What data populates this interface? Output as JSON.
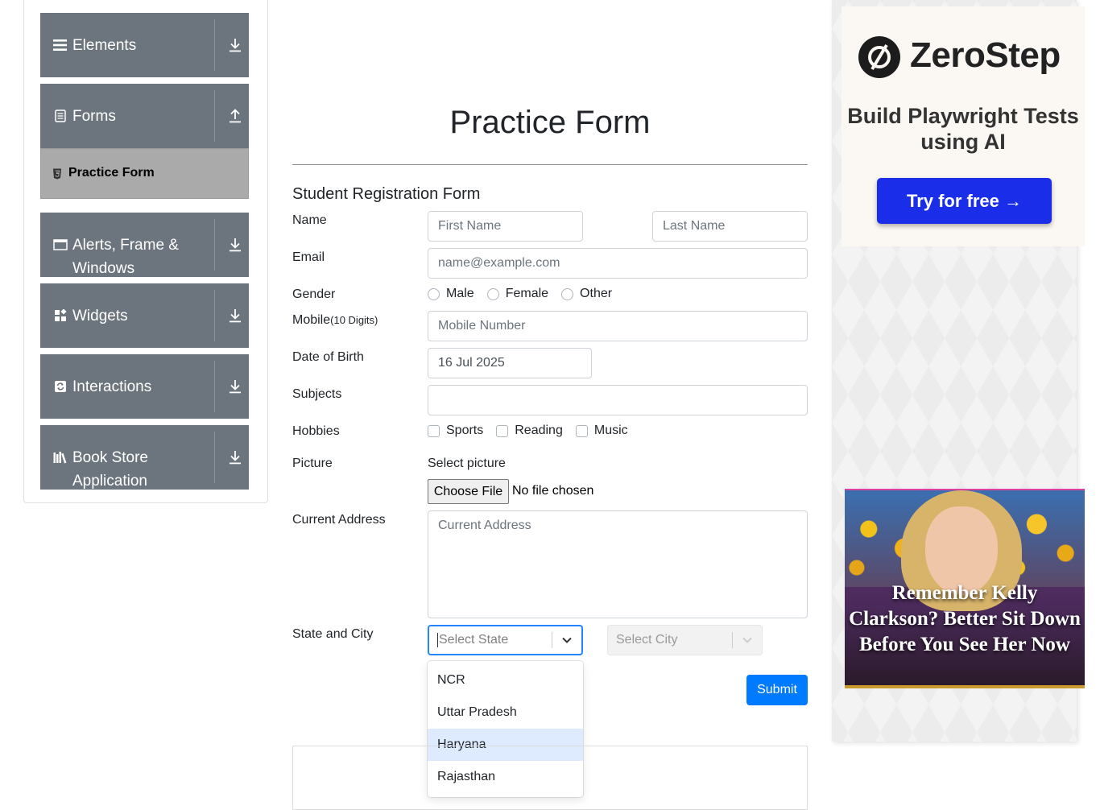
{
  "sidebar": {
    "groups": [
      {
        "label": "Elements",
        "icon": "list-icon",
        "arrow": "download-arrow-icon"
      },
      {
        "label": "Forms",
        "icon": "document-icon",
        "arrow": "upload-arrow-icon"
      },
      {
        "label": "Alerts, Frame & Windows",
        "icon": "window-icon",
        "arrow": "download-arrow-icon"
      },
      {
        "label": "Widgets",
        "icon": "widgets-icon",
        "arrow": "download-arrow-icon"
      },
      {
        "label": "Interactions",
        "icon": "interactions-icon",
        "arrow": "download-arrow-icon"
      },
      {
        "label": "Book Store Application",
        "icon": "books-icon",
        "arrow": "download-arrow-icon"
      }
    ],
    "active_item": "Practice Form"
  },
  "page": {
    "title": "Practice Form",
    "form_heading": "Student Registration Form"
  },
  "form": {
    "name_label": "Name",
    "first_name_placeholder": "First Name",
    "last_name_placeholder": "Last Name",
    "email_label": "Email",
    "email_placeholder": "name@example.com",
    "gender_label": "Gender",
    "gender_options": [
      "Male",
      "Female",
      "Other"
    ],
    "mobile_label": "Mobile",
    "mobile_hint": "(10 Digits)",
    "mobile_placeholder": "Mobile Number",
    "dob_label": "Date of Birth",
    "dob_value": "16 Jul 2025",
    "subjects_label": "Subjects",
    "subjects_value": "",
    "hobbies_label": "Hobbies",
    "hobbies_options": [
      "Sports",
      "Reading",
      "Music"
    ],
    "picture_label": "Picture",
    "picture_select_label": "Select picture",
    "choose_file_label": "Choose File",
    "file_status": "No file chosen",
    "address_label": "Current Address",
    "address_placeholder": "Current Address",
    "state_city_label": "State and City",
    "state_placeholder": "Select State",
    "city_placeholder": "Select City",
    "state_options": [
      "NCR",
      "Uttar Pradesh",
      "Haryana",
      "Rajasthan"
    ],
    "highlighted_state_option": "Haryana",
    "submit_label": "Submit"
  },
  "ads": {
    "zerostep": {
      "brand": "ZeroStep",
      "tagline": "Build Playwright Tests using AI",
      "cta": "Try for free →",
      "cta_color": "#1a2de8"
    },
    "kelly": {
      "headline": "Remember Kelly Clarkson? Better Sit Down Before You See Her Now"
    }
  },
  "colors": {
    "sidebar_group_bg": "#6c757d",
    "active_item_bg": "#aaaaaa",
    "primary": "#007bff",
    "focus_border": "#2684ff",
    "option_highlight": "#deebff"
  }
}
